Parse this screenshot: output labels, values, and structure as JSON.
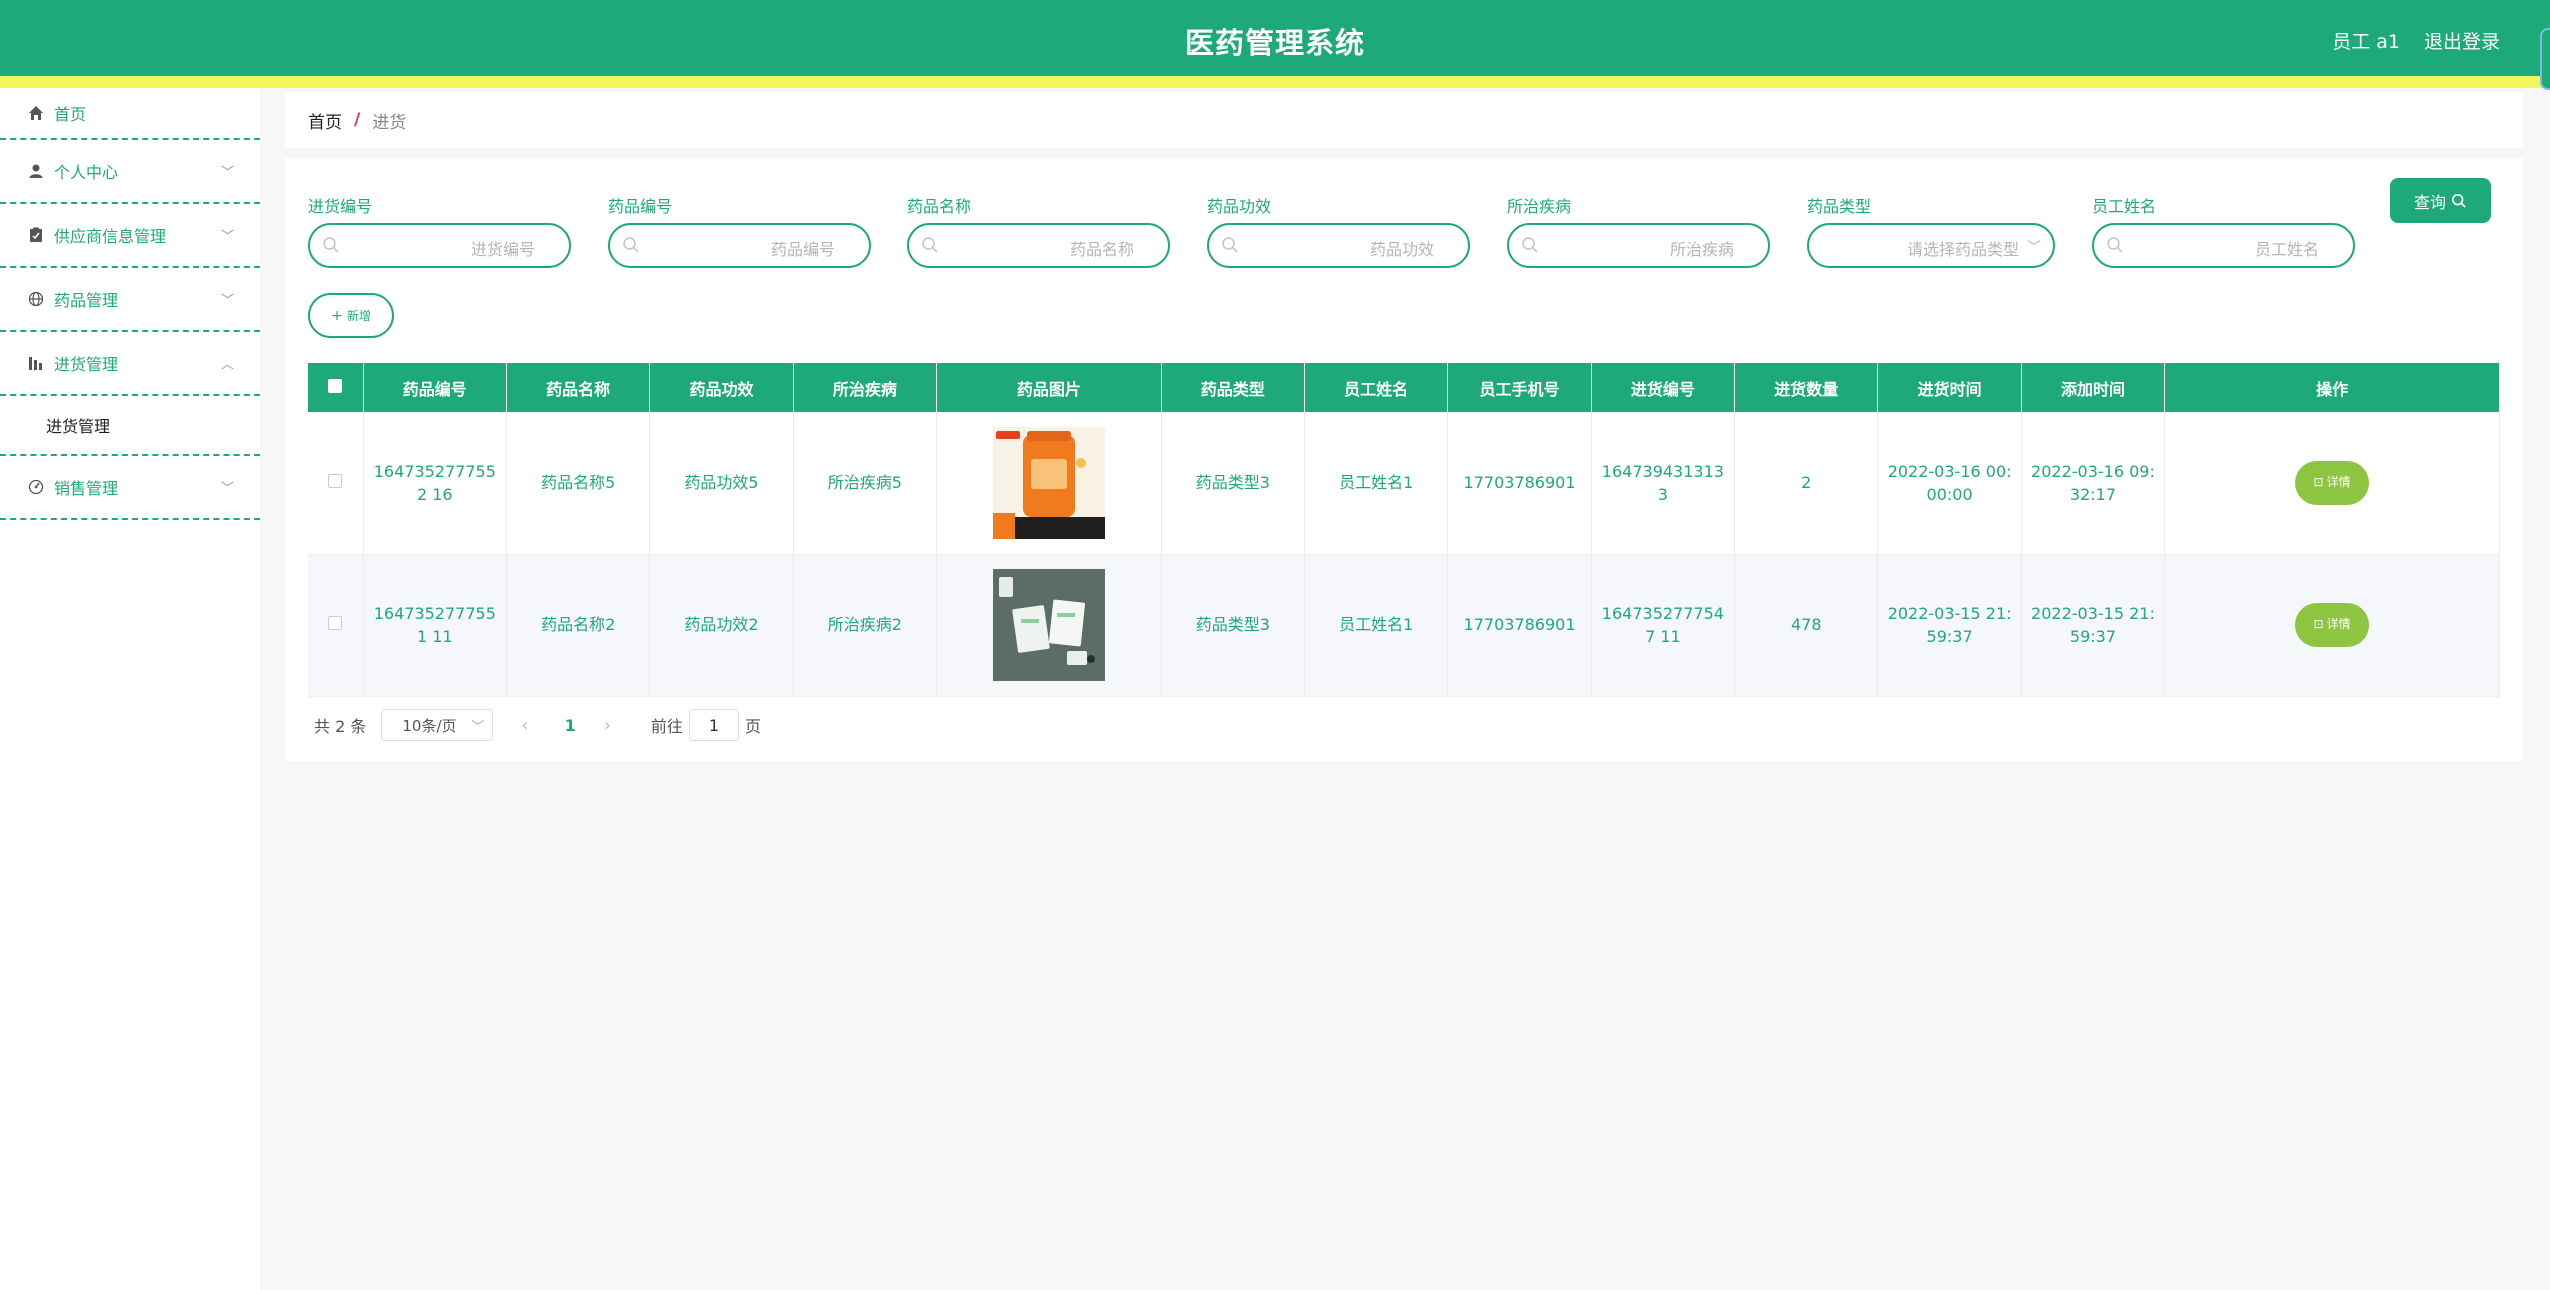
{
  "header": {
    "title": "医药管理系统",
    "user": "员工 a1",
    "logout": "退出登录"
  },
  "sidebar": {
    "items": [
      {
        "label": "首页",
        "icon": "home-icon"
      },
      {
        "label": "个人中心",
        "icon": "user-icon"
      },
      {
        "label": "供应商信息管理",
        "icon": "clipboard-icon"
      },
      {
        "label": "药品管理",
        "icon": "globe-icon"
      },
      {
        "label": "进货管理",
        "icon": "chart-icon"
      },
      {
        "label": "销售管理",
        "icon": "gauge-icon"
      }
    ],
    "submenu": "进货管理"
  },
  "breadcrumb": {
    "home": "首页",
    "separator": "/",
    "current": "进货"
  },
  "search": {
    "fields": [
      {
        "label": "进货编号",
        "placeholder": "进货编号"
      },
      {
        "label": "药品编号",
        "placeholder": "药品编号"
      },
      {
        "label": "药品名称",
        "placeholder": "药品名称"
      },
      {
        "label": "药品功效",
        "placeholder": "药品功效"
      },
      {
        "label": "所治疾病",
        "placeholder": "所治疾病"
      },
      {
        "label": "药品类型",
        "placeholder": "请选择药品类型"
      },
      {
        "label": "员工姓名",
        "placeholder": "员工姓名"
      }
    ],
    "query_button": "查询",
    "add_button": "新增"
  },
  "table": {
    "headers": [
      "药品编号",
      "药品名称",
      "药品功效",
      "所治疾病",
      "药品图片",
      "药品类型",
      "员工姓名",
      "员工手机号",
      "进货编号",
      "进货数量",
      "进货时间",
      "添加时间",
      "操作"
    ],
    "rows": [
      {
        "drug_no": "1647352777552 16",
        "drug_name": "药品名称5",
        "effect": "药品功效5",
        "disease": "所治疾病5",
        "drug_type": "药品类型3",
        "staff_name": "员工姓名1",
        "staff_phone": "17703786901",
        "purchase_no": "1647394313133",
        "quantity": "2",
        "purchase_time": "2022-03-16 00:00:00",
        "add_time": "2022-03-16 09:32:17",
        "action": "详情"
      },
      {
        "drug_no": "1647352777551 11",
        "drug_name": "药品名称2",
        "effect": "药品功效2",
        "disease": "所治疾病2",
        "drug_type": "药品类型3",
        "staff_name": "员工姓名1",
        "staff_phone": "17703786901",
        "purchase_no": "1647352777547 11",
        "quantity": "478",
        "purchase_time": "2022-03-15 21:59:37",
        "add_time": "2022-03-15 21:59:37",
        "action": "详情"
      }
    ]
  },
  "pagination": {
    "total": "共 2 条",
    "page_size": "10条/页",
    "current_page": "1",
    "goto_label": "前往",
    "goto_value": "1",
    "page_suffix": "页"
  },
  "colors": {
    "primary": "#1eaa78",
    "accent_stripe": "#f2f65a",
    "detail_button": "#8dc540",
    "breadcrumb_separator": "#e8343d"
  }
}
